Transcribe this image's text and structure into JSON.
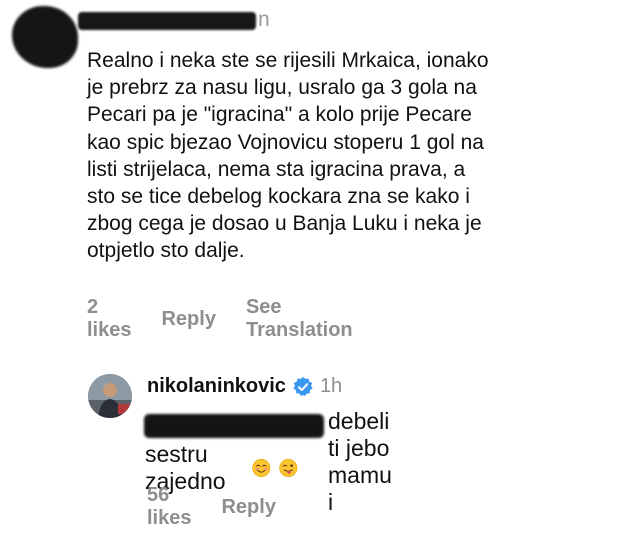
{
  "comment": {
    "username_suffix": "n",
    "text": "Realno i neka ste se rijesili Mrkaica, ionako\nje prebrz za nasu ligu, usralo ga 3 gola na\nPecari pa je \"igracina\" a kolo prije Pecare\nkao spic bjezao Vojnovicu stoperu 1 gol na\nlisti strijelaca, nema sta igracina prava, a\nsto se tice debelog kockara zna se kako i\nzbog cega je dosao u Banja Luku i neka je\notpjetlo sto dalje.",
    "likes": "2 likes",
    "reply_label": "Reply",
    "translate_label": "See Translation"
  },
  "reply": {
    "username": "nikolaninkovic",
    "time": "1h",
    "text_line1": "debeli ti jebo mamu i",
    "text_line2": "sestru zajedno",
    "emojis": [
      "smiling-blush-emoji",
      "winking-tongue-emoji"
    ],
    "likes": "56 likes",
    "reply_label": "Reply",
    "verified_color": "#3897f0"
  }
}
